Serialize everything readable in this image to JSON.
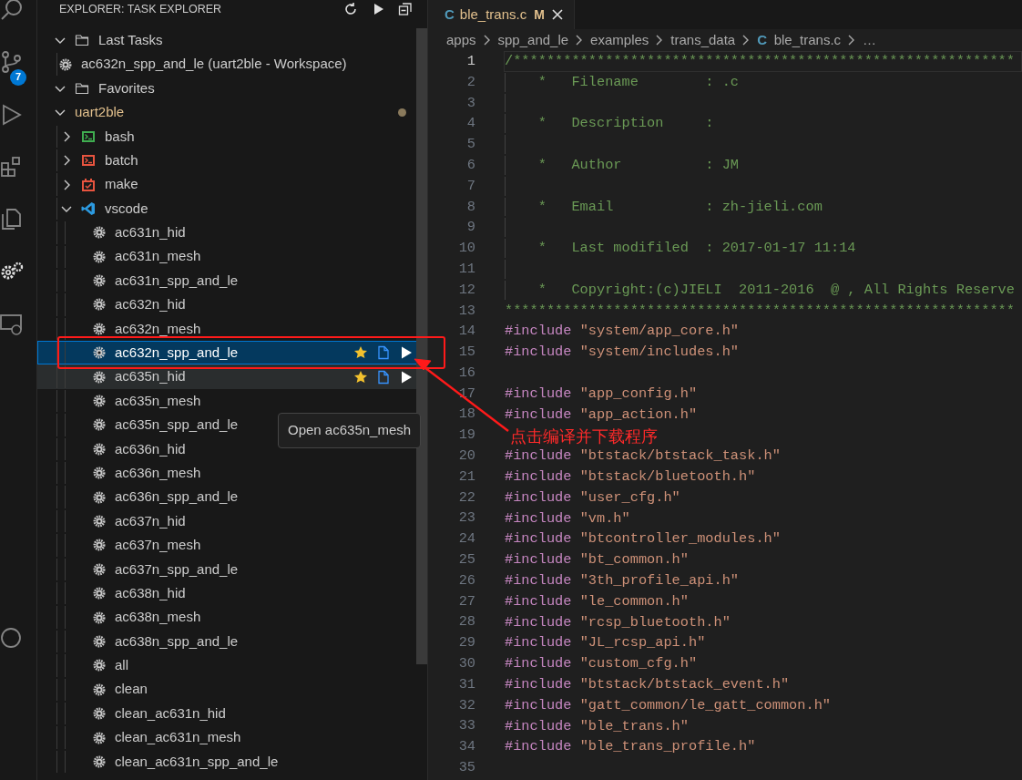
{
  "activity_bar": {
    "items": [
      {
        "kind": "search",
        "selected": false
      },
      {
        "kind": "source-control",
        "selected": false,
        "badge": "7"
      },
      {
        "kind": "run",
        "selected": false
      },
      {
        "kind": "extensions",
        "selected": false
      },
      {
        "kind": "explorer",
        "selected": false
      },
      {
        "kind": "tasks",
        "selected": true
      },
      {
        "kind": "remote",
        "selected": false
      },
      {
        "kind": "account",
        "selected": false
      }
    ]
  },
  "sidebar": {
    "title": "EXPLORER: TASK EXPLORER",
    "tree": [
      {
        "label": "Last Tasks",
        "kind": "folder",
        "expanded": true,
        "modified": false,
        "children": [
          {
            "label": "ac632n_spp_and_le (uart2ble - Workspace)",
            "kind": "gear",
            "selected": false,
            "hovered": false
          }
        ]
      },
      {
        "label": "Favorites",
        "kind": "folder",
        "expanded": true,
        "modified": false
      },
      {
        "label": "uart2ble",
        "expanded": true,
        "modified": true,
        "children": [
          {
            "label": "bash",
            "kind": "terminal",
            "color": "#3fae50",
            "expanded": false
          },
          {
            "label": "batch",
            "kind": "terminal",
            "color": "#e8543f",
            "expanded": false
          },
          {
            "label": "make",
            "kind": "make",
            "color": "#e8543f",
            "expanded": false
          },
          {
            "label": "vscode",
            "kind": "vscode",
            "color": "#2c9ae0",
            "expanded": true,
            "children": [
              {
                "label": "ac631n_hid",
                "kind": "gear",
                "selected": false,
                "hovered": false
              },
              {
                "label": "ac631n_mesh",
                "kind": "gear",
                "selected": false,
                "hovered": false
              },
              {
                "label": "ac631n_spp_and_le",
                "kind": "gear",
                "selected": false,
                "hovered": false
              },
              {
                "label": "ac632n_hid",
                "kind": "gear",
                "selected": false,
                "hovered": false
              },
              {
                "label": "ac632n_mesh",
                "kind": "gear",
                "selected": false,
                "hovered": false
              },
              {
                "label": "ac632n_spp_and_le",
                "kind": "gear",
                "selected": true,
                "hovered": false
              },
              {
                "label": "ac635n_hid",
                "kind": "gear",
                "selected": false,
                "hovered": true
              },
              {
                "label": "ac635n_mesh",
                "kind": "gear",
                "selected": false,
                "hovered": false
              },
              {
                "label": "ac635n_spp_and_le",
                "kind": "gear",
                "selected": false,
                "hovered": false
              },
              {
                "label": "ac636n_hid",
                "kind": "gear",
                "selected": false,
                "hovered": false
              },
              {
                "label": "ac636n_mesh",
                "kind": "gear",
                "selected": false,
                "hovered": false
              },
              {
                "label": "ac636n_spp_and_le",
                "kind": "gear",
                "selected": false,
                "hovered": false
              },
              {
                "label": "ac637n_hid",
                "kind": "gear",
                "selected": false,
                "hovered": false
              },
              {
                "label": "ac637n_mesh",
                "kind": "gear",
                "selected": false,
                "hovered": false
              },
              {
                "label": "ac637n_spp_and_le",
                "kind": "gear",
                "selected": false,
                "hovered": false
              },
              {
                "label": "ac638n_hid",
                "kind": "gear",
                "selected": false,
                "hovered": false
              },
              {
                "label": "ac638n_mesh",
                "kind": "gear",
                "selected": false,
                "hovered": false
              },
              {
                "label": "ac638n_spp_and_le",
                "kind": "gear",
                "selected": false,
                "hovered": false
              },
              {
                "label": "all",
                "kind": "gear",
                "selected": false,
                "hovered": false
              },
              {
                "label": "clean",
                "kind": "gear",
                "selected": false,
                "hovered": false
              },
              {
                "label": "clean_ac631n_hid",
                "kind": "gear",
                "selected": false,
                "hovered": false
              },
              {
                "label": "clean_ac631n_mesh",
                "kind": "gear",
                "selected": false,
                "hovered": false
              },
              {
                "label": "clean_ac631n_spp_and_le",
                "kind": "gear",
                "selected": false,
                "hovered": false
              }
            ]
          }
        ]
      }
    ]
  },
  "tooltip": {
    "text": "Open ac635n_mesh"
  },
  "editor": {
    "tabs": [
      {
        "label": "ble_trans.c",
        "icon_text": "C",
        "status": "M",
        "selected": true
      }
    ],
    "breadcrumb": [
      {
        "label": "apps"
      },
      {
        "label": "spp_and_le"
      },
      {
        "label": "examples"
      },
      {
        "label": "trans_data"
      },
      {
        "label": "ble_trans.c",
        "icon_text": "C"
      },
      {
        "label": "…"
      }
    ],
    "lines": [
      {
        "number": "1",
        "kind": "rule",
        "text": "/************************************************************",
        "current": true
      },
      {
        "number": "2",
        "kind": "comment",
        "text": "    *   Filename        : .c",
        "current": false
      },
      {
        "number": "3",
        "kind": "comment",
        "current": false
      },
      {
        "number": "4",
        "kind": "comment",
        "text": "    *   Description     :",
        "current": false
      },
      {
        "number": "5",
        "kind": "comment",
        "current": false
      },
      {
        "number": "6",
        "kind": "comment",
        "text": "    *   Author          : JM",
        "current": false
      },
      {
        "number": "7",
        "kind": "comment",
        "current": false
      },
      {
        "number": "8",
        "kind": "comment",
        "text": "    *   Email           : zh-jieli.com",
        "current": false
      },
      {
        "number": "9",
        "kind": "comment",
        "current": false
      },
      {
        "number": "10",
        "kind": "comment",
        "text": "    *   Last modifiled  : 2017-01-17 11:14",
        "current": false
      },
      {
        "number": "11",
        "kind": "comment",
        "current": false
      },
      {
        "number": "12",
        "kind": "comment",
        "text": "    *   Copyright:(c)JIELI  2011-2016  @ , All Rights Reserve",
        "current": false
      },
      {
        "number": "13",
        "kind": "rule",
        "text": "*************************************************************",
        "current": false
      },
      {
        "number": "14",
        "kind": "include",
        "directive": "#include",
        "path": "\"system/app_core.h\"",
        "current": false
      },
      {
        "number": "15",
        "kind": "include",
        "directive": "#include",
        "path": "\"system/includes.h\"",
        "current": false
      },
      {
        "number": "16",
        "kind": "blank",
        "current": false
      },
      {
        "number": "17",
        "kind": "include",
        "directive": "#include",
        "path": "\"app_config.h\"",
        "current": false
      },
      {
        "number": "18",
        "kind": "include",
        "directive": "#include",
        "path": "\"app_action.h\"",
        "current": false
      },
      {
        "number": "19",
        "kind": "blank",
        "current": false
      },
      {
        "number": "20",
        "kind": "include",
        "directive": "#include",
        "path": "\"btstack/btstack_task.h\"",
        "current": false
      },
      {
        "number": "21",
        "kind": "include",
        "directive": "#include",
        "path": "\"btstack/bluetooth.h\"",
        "current": false
      },
      {
        "number": "22",
        "kind": "include",
        "directive": "#include",
        "path": "\"user_cfg.h\"",
        "current": false
      },
      {
        "number": "23",
        "kind": "include",
        "directive": "#include",
        "path": "\"vm.h\"",
        "current": false
      },
      {
        "number": "24",
        "kind": "include",
        "directive": "#include",
        "path": "\"btcontroller_modules.h\"",
        "current": false
      },
      {
        "number": "25",
        "kind": "include",
        "directive": "#include",
        "path": "\"bt_common.h\"",
        "current": false
      },
      {
        "number": "26",
        "kind": "include",
        "directive": "#include",
        "path": "\"3th_profile_api.h\"",
        "current": false
      },
      {
        "number": "27",
        "kind": "include",
        "directive": "#include",
        "path": "\"le_common.h\"",
        "current": false
      },
      {
        "number": "28",
        "kind": "include",
        "directive": "#include",
        "path": "\"rcsp_bluetooth.h\"",
        "current": false
      },
      {
        "number": "29",
        "kind": "include",
        "directive": "#include",
        "path": "\"JL_rcsp_api.h\"",
        "current": false
      },
      {
        "number": "30",
        "kind": "include",
        "directive": "#include",
        "path": "\"custom_cfg.h\"",
        "current": false
      },
      {
        "number": "31",
        "kind": "include",
        "directive": "#include",
        "path": "\"btstack/btstack_event.h\"",
        "current": false
      },
      {
        "number": "32",
        "kind": "include",
        "directive": "#include",
        "path": "\"gatt_common/le_gatt_common.h\"",
        "current": false
      },
      {
        "number": "33",
        "kind": "include",
        "directive": "#include",
        "path": "\"ble_trans.h\"",
        "current": false
      },
      {
        "number": "34",
        "kind": "include",
        "directive": "#include",
        "path": "\"ble_trans_profile.h\"",
        "current": false
      },
      {
        "number": "35",
        "kind": "blank",
        "current": false
      }
    ]
  },
  "annotation": {
    "text": "点击编译并下载程序"
  }
}
